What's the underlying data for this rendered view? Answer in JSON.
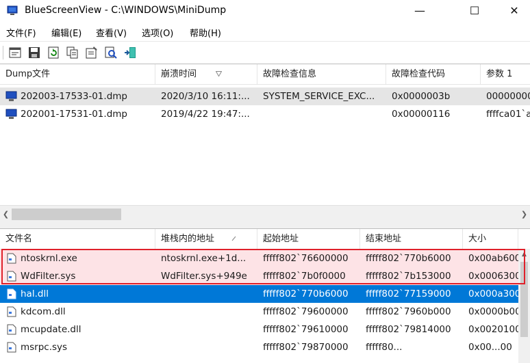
{
  "window": {
    "title": "BlueScreenView  -  C:\\WINDOWS\\MiniDump",
    "minimize_glyph": "—",
    "maximize_glyph": "☐",
    "close_glyph": "✕",
    "app_icon": "bluescreen-app-icon"
  },
  "menu": [
    "文件(F)",
    "编辑(E)",
    "查看(V)",
    "选项(O)",
    "帮助(H)"
  ],
  "toolbar": {
    "icons": [
      "html-report-icon",
      "save-icon",
      "refresh-icon",
      "copy-icon",
      "properties-icon",
      "find-icon",
      "exit-icon"
    ]
  },
  "dump_table": {
    "columns": [
      "Dump文件",
      "崩溃时间",
      "故障检查信息",
      "故障检查代码",
      "参数 1"
    ],
    "rows": [
      {
        "file": "202003-17533-01.dmp",
        "time": "2020/3/10 16:11:...",
        "info": "SYSTEM_SERVICE_EXC...",
        "code": "0x0000003b",
        "param1": "00000000"
      },
      {
        "file": "202001-17531-01.dmp",
        "time": "2019/4/22 19:47:...",
        "info": "",
        "code": "0x00000116",
        "param1": "ffffca01`a"
      }
    ]
  },
  "module_table": {
    "columns": [
      "文件名",
      "堆栈内的地址",
      "起始地址",
      "结束地址",
      "大小"
    ],
    "rows": [
      {
        "name": "ntoskrnl.exe",
        "stack": "ntoskrnl.exe+1d...",
        "start": "fffff802`76600000",
        "end": "fffff802`770b6000",
        "size": "0x00ab600"
      },
      {
        "name": "WdFilter.sys",
        "stack": "WdFilter.sys+949e",
        "start": "fffff802`7b0f0000",
        "end": "fffff802`7b153000",
        "size": "0x0006300"
      },
      {
        "name": "hal.dll",
        "stack": "",
        "start": "fffff802`770b6000",
        "end": "fffff802`77159000",
        "size": "0x000a300"
      },
      {
        "name": "kdcom.dll",
        "stack": "",
        "start": "fffff802`79600000",
        "end": "fffff802`7960b000",
        "size": "0x0000b00"
      },
      {
        "name": "mcupdate.dll",
        "stack": "",
        "start": "fffff802`79610000",
        "end": "fffff802`79814000",
        "size": "0x0020100"
      },
      {
        "name": "msrpc.sys",
        "stack": "",
        "start": "fffff802`79870000",
        "end": "fffff80...",
        "size": "0x00...00"
      }
    ]
  },
  "colors": {
    "selection": "#0078d7",
    "highlight_box": "#e0202a",
    "highlight_fill": "#fde3e6",
    "dump_icon": "#1f4fbf"
  }
}
